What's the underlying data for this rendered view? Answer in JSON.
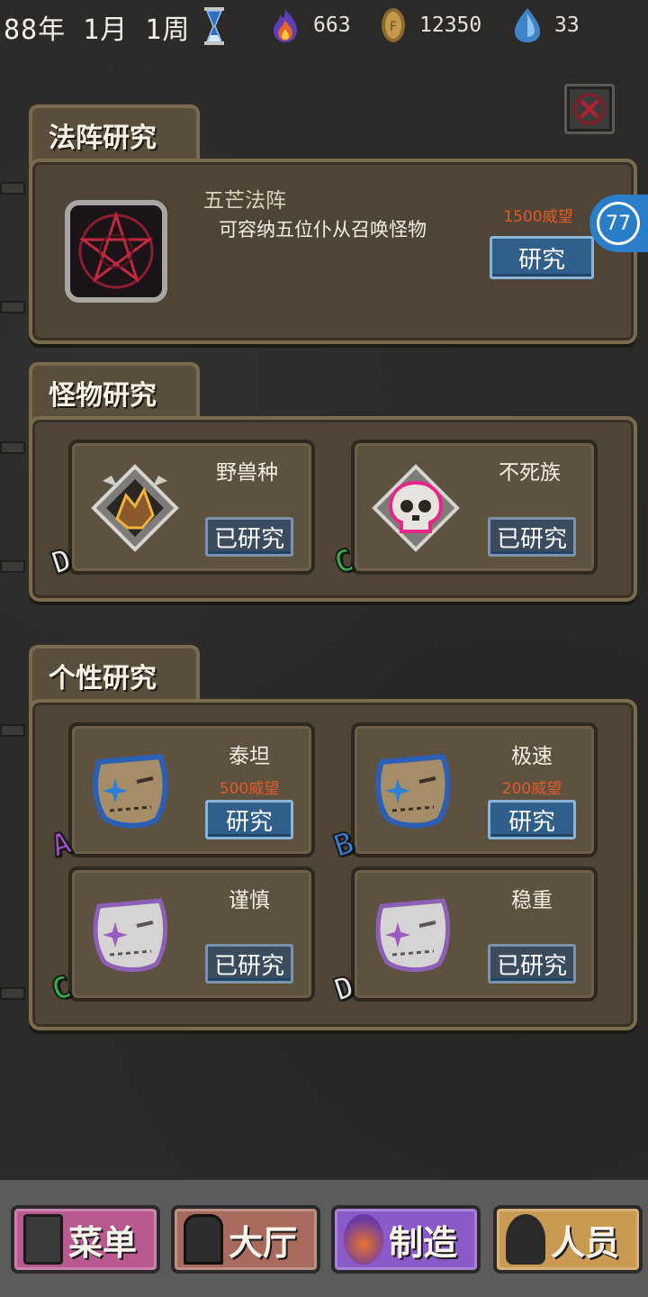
{
  "status_bar": {
    "date": "88年 1月 1周",
    "resources": [
      {
        "icon": "flame-icon",
        "value": "663"
      },
      {
        "icon": "coin-icon",
        "value": "12350"
      },
      {
        "icon": "crystal-icon",
        "value": "33"
      }
    ]
  },
  "circle_research": {
    "title": "法阵研究",
    "item_name": "五芒法阵",
    "item_desc": "可容纳五位仆从召唤怪物",
    "cost": "1500威望",
    "button": "研究",
    "badge": "77"
  },
  "monster_research": {
    "title": "怪物研究",
    "items": [
      {
        "name": "野兽种",
        "button": "已研究",
        "grade": "D"
      },
      {
        "name": "不死族",
        "button": "已研究",
        "grade": "C"
      }
    ]
  },
  "trait_research": {
    "title": "个性研究",
    "items": [
      {
        "name": "泰坦",
        "cost": "500威望",
        "button": "研究",
        "grade": "A"
      },
      {
        "name": "极速",
        "cost": "200威望",
        "button": "研究",
        "grade": "B"
      },
      {
        "name": "谨慎",
        "button": "已研究",
        "grade": "C"
      },
      {
        "name": "稳重",
        "button": "已研究",
        "grade": "D"
      }
    ]
  },
  "bottom_nav": [
    {
      "label": "菜单",
      "icon": "phone-icon"
    },
    {
      "label": "大厅",
      "icon": "door-icon"
    },
    {
      "label": "制造",
      "icon": "craft-icon"
    },
    {
      "label": "人员",
      "icon": "character-icon"
    }
  ]
}
